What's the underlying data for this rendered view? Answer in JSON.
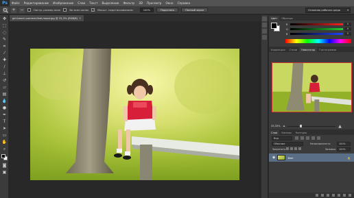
{
  "app": {
    "logo": "Ps",
    "menu": [
      "Файл",
      "Редактирование",
      "Изображение",
      "Слои",
      "Текст",
      "Выделение",
      "Фильтр",
      "3D",
      "Просмотр",
      "Окно",
      "Справка"
    ]
  },
  "options_bar": {
    "fit_label": "Настр. размер окон",
    "all_windows_label": "Во всех окнах",
    "scrubby_label": "Масшт. перетаскиванием",
    "zoom_value": "100%",
    "fit_button": "Подогнать",
    "fill_button": "Полный экран",
    "workspace": "Основная рабочая среда"
  },
  "document": {
    "tab_title": "girl-bench-summer-feel-mood.jpg @ 33,3% (RGB/8)",
    "close": "×"
  },
  "color_panel": {
    "tabs": [
      "Цвет",
      "Образцы"
    ],
    "sliders": [
      {
        "label": "R",
        "value": "0",
        "color": "#d23030"
      },
      {
        "label": "G",
        "value": "0",
        "color": "#30b040"
      },
      {
        "label": "B",
        "value": "0",
        "color": "#3050d0"
      }
    ]
  },
  "navigator_panel": {
    "tabs": [
      "Коррекция",
      "Стили",
      "Навигатор",
      "Гистограмма"
    ],
    "zoom": "33,33%"
  },
  "layers_panel": {
    "tabs": [
      "Слои",
      "Каналы",
      "Контуры"
    ],
    "filter_label": "Вид",
    "blend_mode": "Обычные",
    "opacity_label": "Непрозрачность:",
    "opacity_value": "100%",
    "lock_label": "Закрепить:",
    "fill_label": "Заливка:",
    "fill_value": "100%",
    "layers": [
      {
        "name": "Фон",
        "visible": true,
        "locked": true
      }
    ]
  },
  "colors": {
    "accent": "#c33333",
    "selected_layer": "#5a6e86"
  }
}
